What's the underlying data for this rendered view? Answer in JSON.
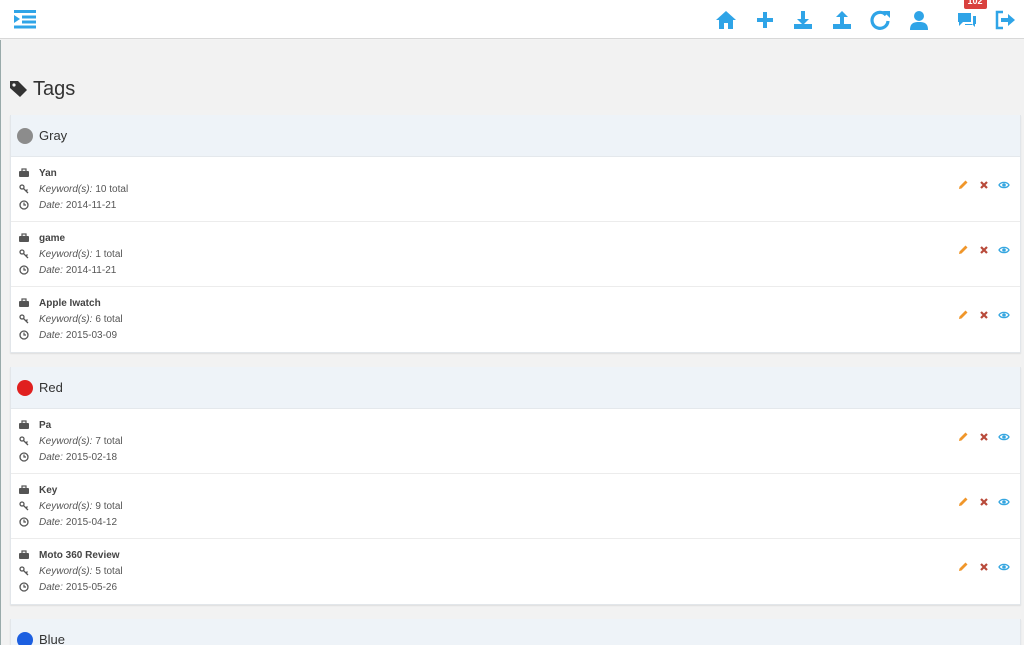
{
  "page": {
    "title": "Tags"
  },
  "topbar": {
    "notifications_count": "102"
  },
  "colors": {
    "accent": "#2fa4e7",
    "edit": "#f0962a",
    "delete": "#b84a3a",
    "view": "#35a6e0"
  },
  "groups": [
    {
      "name": "Gray",
      "color": "#8c8c8c",
      "items": [
        {
          "title": "Yan",
          "keywords_label": "Keyword(s):",
          "keywords": "10 total",
          "date_label": "Date:",
          "date": "2014-11-21"
        },
        {
          "title": "game",
          "keywords_label": "Keyword(s):",
          "keywords": "1 total",
          "date_label": "Date:",
          "date": "2014-11-21"
        },
        {
          "title": "Apple Iwatch",
          "keywords_label": "Keyword(s):",
          "keywords": "6 total",
          "date_label": "Date:",
          "date": "2015-03-09"
        }
      ]
    },
    {
      "name": "Red",
      "color": "#e0201f",
      "items": [
        {
          "title": "Pa",
          "keywords_label": "Keyword(s):",
          "keywords": "7 total",
          "date_label": "Date:",
          "date": "2015-02-18"
        },
        {
          "title": "Key",
          "keywords_label": "Keyword(s):",
          "keywords": "9 total",
          "date_label": "Date:",
          "date": "2015-04-12"
        },
        {
          "title": "Moto 360 Review",
          "keywords_label": "Keyword(s):",
          "keywords": "5 total",
          "date_label": "Date:",
          "date": "2015-05-26"
        }
      ]
    },
    {
      "name": "Blue",
      "color": "#1c5fe0",
      "items": []
    }
  ]
}
